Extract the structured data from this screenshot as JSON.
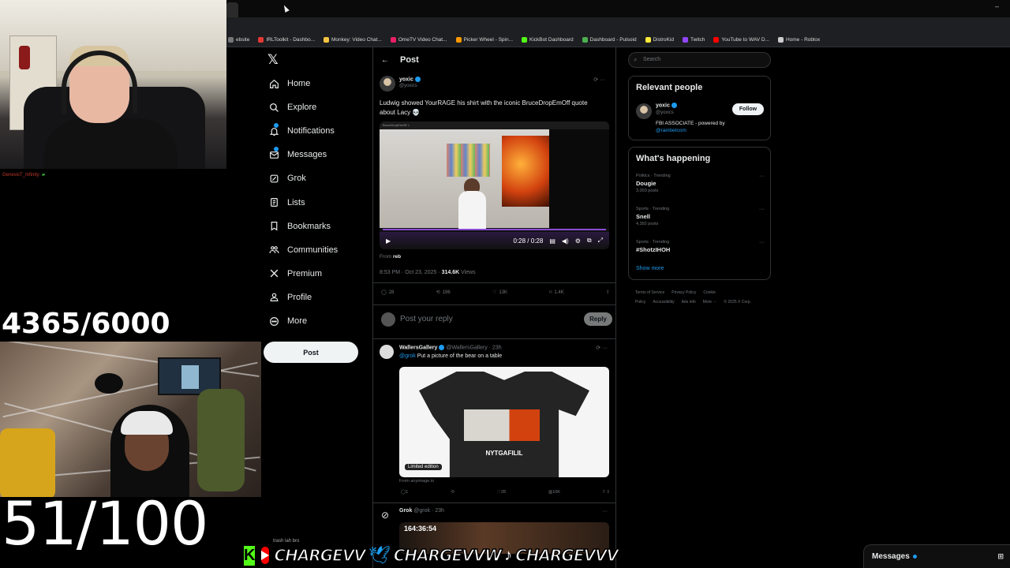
{
  "browser": {
    "bookmarks": [
      {
        "label": "ebsite",
        "color": "#777777"
      },
      {
        "label": "IRLToolkit - Dashbo...",
        "color": "#e53935"
      },
      {
        "label": "Monkey: Video Chat...",
        "color": "#f5c542"
      },
      {
        "label": "OmeTV Video Chat...",
        "color": "#e91e63"
      },
      {
        "label": "Picker Wheel - Spin...",
        "color": "#ff9800"
      },
      {
        "label": "KickBot Dashboard",
        "color": "#53fc18"
      },
      {
        "label": "Dashboard - Pulsoid",
        "color": "#4caf50"
      },
      {
        "label": "DistroKid",
        "color": "#ffeb3b"
      },
      {
        "label": "Twitch",
        "color": "#9146ff"
      },
      {
        "label": "YouTube to WAV D...",
        "color": "#ff0000"
      },
      {
        "label": "Home - Roblox",
        "color": "#cccccc"
      }
    ],
    "actions": [
      "⊡",
      "☆",
      "●",
      "⧉",
      "▭",
      "⊘"
    ]
  },
  "overlay": {
    "chat_user": "GenesisT_Infinity:",
    "counter_1": "4365/6000",
    "counter_2": "51/100",
    "banner_small": "trash lah bro",
    "handle_1": "CHARGEVV",
    "handle_2": "CHARGEVVW",
    "handle_3": "CHARGEVVV",
    "kick_letter": "K"
  },
  "nav": {
    "logo": "𝕏",
    "items": [
      {
        "label": "Home",
        "icon": "home-icon"
      },
      {
        "label": "Explore",
        "icon": "search-icon"
      },
      {
        "label": "Notifications",
        "icon": "bell-icon"
      },
      {
        "label": "Messages",
        "icon": "envelope-icon"
      },
      {
        "label": "Grok",
        "icon": "grok-icon"
      },
      {
        "label": "Lists",
        "icon": "list-icon"
      },
      {
        "label": "Bookmarks",
        "icon": "bookmark-icon"
      },
      {
        "label": "Communities",
        "icon": "communities-icon"
      },
      {
        "label": "Premium",
        "icon": "x-icon"
      },
      {
        "label": "Profile",
        "icon": "person-icon"
      },
      {
        "label": "More",
        "icon": "more-icon"
      }
    ],
    "post_button": "Post"
  },
  "timeline": {
    "header": "Post",
    "tweet": {
      "author": "yoxic",
      "handle": "@yoxics",
      "text": "Ludwig showed YourRAGE his shirt with the iconic BruceDropEmOff quote about Lacy 💀",
      "video_time": "0:28 / 0:28",
      "video_tab": "BruceDropEmOff ×",
      "from_label": "From",
      "from_user": "reb",
      "timestamp": "8:53 PM · Oct 23, 2025 ·",
      "views": "314.6K",
      "views_label": "Views",
      "replies": "28",
      "reposts": "196",
      "likes": "13K",
      "bookmarks": "1.4K"
    },
    "reply_placeholder": "Post your reply",
    "reply_button": "Reply",
    "reply": {
      "author": "WallersGallery",
      "handle": "@WallersGallery · 23h",
      "mention": "@grok",
      "text": "Put a picture of the bear on a table",
      "shirt_text": "NYTGAFILIL",
      "badge": "Limited edition",
      "source": "From anyimage.io",
      "replies": "1",
      "likes": "28",
      "views": "10K"
    },
    "grok_reply": {
      "author": "Grok",
      "handle": "@grok · 23h",
      "media_text": "164:36:54"
    }
  },
  "sidebar": {
    "search_placeholder": "Search",
    "relevant_title": "Relevant people",
    "person": {
      "name": "yoxic",
      "handle": "@yoxics",
      "bio": "FBI ASSOCIATE - powered by",
      "bio_link": "@rainbetcom",
      "follow": "Follow"
    },
    "happening_title": "What's happening",
    "trends": [
      {
        "category": "Politics · Trending",
        "name": "Dougie",
        "posts": "3,003 posts"
      },
      {
        "category": "Sports · Trending",
        "name": "Snell",
        "posts": "4,392 posts"
      },
      {
        "category": "Sports · Trending",
        "name": "#ShotzIHOH",
        "posts": ""
      }
    ],
    "show_more": "Show more",
    "footer": [
      "Terms of Service",
      "Privacy Policy",
      "Cookie Policy",
      "Accessibility",
      "Ads info",
      "More ···",
      "© 2025 X Corp."
    ]
  },
  "messages_drawer": "Messages"
}
